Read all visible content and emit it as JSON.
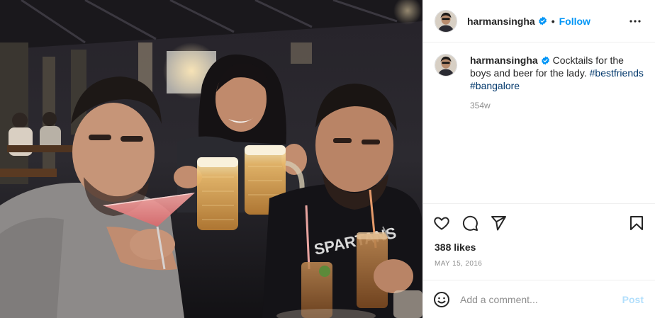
{
  "header": {
    "username": "harmansingha",
    "separator": "•",
    "follow_label": "Follow",
    "more_icon": "more-horizontal-icon"
  },
  "caption": {
    "username": "harmansingha",
    "text": "Cocktails for the boys and beer for the lady.",
    "hashtags": [
      "#bestfriends",
      "#bangalore"
    ],
    "time_ago": "354w"
  },
  "actions": {
    "icons": [
      "heart-icon",
      "comment-icon",
      "share-icon",
      "bookmark-icon"
    ]
  },
  "likes": "388 likes",
  "date": "MAY 15, 2016",
  "comment_box": {
    "placeholder": "Add a comment...",
    "post_label": "Post"
  },
  "colors": {
    "accent": "#0095f6",
    "verified": "#0095f6",
    "hashtag": "#00376b",
    "post_disabled": "#b2dffc"
  }
}
